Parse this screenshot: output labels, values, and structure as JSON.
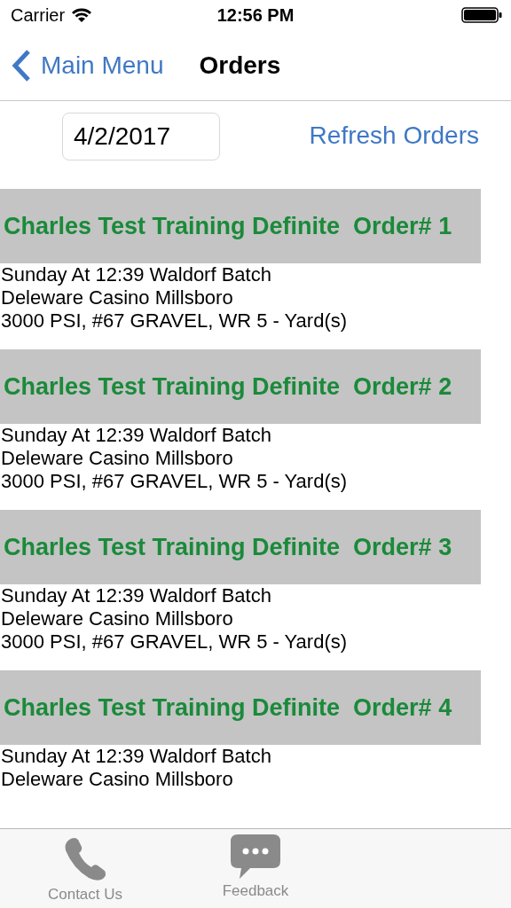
{
  "status_bar": {
    "carrier": "Carrier",
    "time": "12:56 PM"
  },
  "nav": {
    "back": "Main Menu",
    "title": "Orders"
  },
  "date_field": {
    "value": "4/2/2017"
  },
  "refresh_button": "Refresh Orders",
  "orders": [
    {
      "title": "Charles Test Training Definite  Order# 1",
      "lines": [
        "Sunday At 12:39 Waldorf Batch",
        "Deleware Casino Millsboro",
        "3000 PSI, #67 GRAVEL, WR 5 - Yard(s)"
      ]
    },
    {
      "title": "Charles Test Training Definite  Order# 2",
      "lines": [
        "Sunday At 12:39 Waldorf Batch",
        "Deleware Casino Millsboro",
        "3000 PSI, #67 GRAVEL, WR 5 - Yard(s)"
      ]
    },
    {
      "title": "Charles Test Training Definite  Order# 3",
      "lines": [
        "Sunday At 12:39 Waldorf Batch",
        "Deleware Casino Millsboro",
        "3000 PSI, #67 GRAVEL, WR 5 - Yard(s)"
      ]
    },
    {
      "title": "Charles Test Training Definite  Order# 4",
      "lines": [
        "Sunday At 12:39 Waldorf Batch",
        "Deleware Casino Millsboro"
      ]
    }
  ],
  "tab_bar": [
    {
      "kind": "phone",
      "label": "Contact Us"
    },
    {
      "kind": "chat",
      "label": "Feedback"
    }
  ]
}
